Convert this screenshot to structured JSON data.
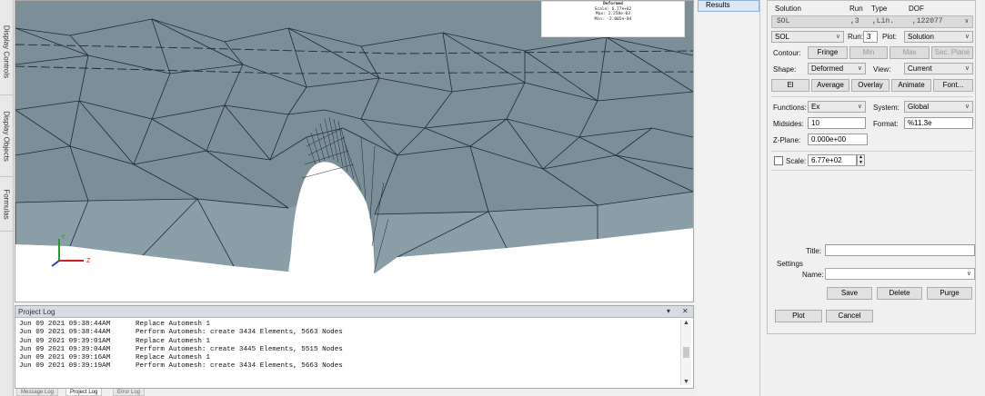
{
  "side_tabs": [
    "Display Controls",
    "Display Objects",
    "Formulas"
  ],
  "legend": {
    "lines": [
      "Deformed",
      "Scale: 6.77e+02",
      "Max: 2.258e-03",
      "Min: -2.005e-04"
    ]
  },
  "triad": {
    "x": "Z",
    "y": "Y"
  },
  "project_log": {
    "title": "Project Log",
    "controls": [
      "▾",
      "✕"
    ],
    "lines": [
      {
        "time": "Jun 09 2021 09:38:44AM",
        "msg": "Replace Automesh 1"
      },
      {
        "time": "Jun 09 2021 09:38:44AM",
        "msg": "Perform Automesh: create 3434 Elements, 5663 Nodes"
      },
      {
        "time": "Jun 09 2021 09:39:01AM",
        "msg": "Replace Automesh 1"
      },
      {
        "time": "Jun 09 2021 09:39:04AM",
        "msg": "Perform Automesh: create 3445 Elements, 5515 Nodes"
      },
      {
        "time": "Jun 09 2021 09:39:16AM",
        "msg": "Replace Automesh 1"
      },
      {
        "time": "Jun 09 2021 09:39:19AM",
        "msg": "Perform Automesh: create 3434 Elements, 5663 Nodes"
      }
    ],
    "tabs": [
      "Message Log",
      "Project Log",
      "Error Log"
    ]
  },
  "results_tab": "Results",
  "panel": {
    "headers": {
      "solution": "Solution",
      "run": "Run",
      "type": "Type",
      "dof": "DOF"
    },
    "sol_row": {
      "name": "SOL",
      "run": ",3",
      "type": ",Lin.",
      "dof": ",122077"
    },
    "sol_combo": "SOL",
    "run_label": "Run:",
    "run_value": "3",
    "plot_label": "Plot:",
    "plot_value": "Solution",
    "contour_label": "Contour:",
    "fringe": "Fringe",
    "min": "Min",
    "max": "Max",
    "sec_plane": "Sec. Plane",
    "shape_label": "Shape:",
    "shape_value": "Deformed",
    "view_label": "View:",
    "view_value": "Current",
    "el": "El",
    "average": "Average",
    "overlay": "Overlay",
    "animate": "Animate",
    "font": "Font...",
    "functions_label": "Functions:",
    "functions_value": "Ex",
    "system_label": "System:",
    "system_value": "Global",
    "midsides_label": "Midsides:",
    "midsides_value": "10",
    "format_label": "Format:",
    "format_value": "%11.3e",
    "zplane_label": "Z-Plane:",
    "zplane_value": "0.000e+00",
    "scale_label": "Scale:",
    "scale_value": "6.77e+02",
    "title_label": "Title:",
    "title_value": "",
    "settings_label": "Settings",
    "name_label": "Name:",
    "name_value": "",
    "save": "Save",
    "delete": "Delete",
    "purge": "Purge",
    "plot": "Plot",
    "cancel": "Cancel"
  }
}
